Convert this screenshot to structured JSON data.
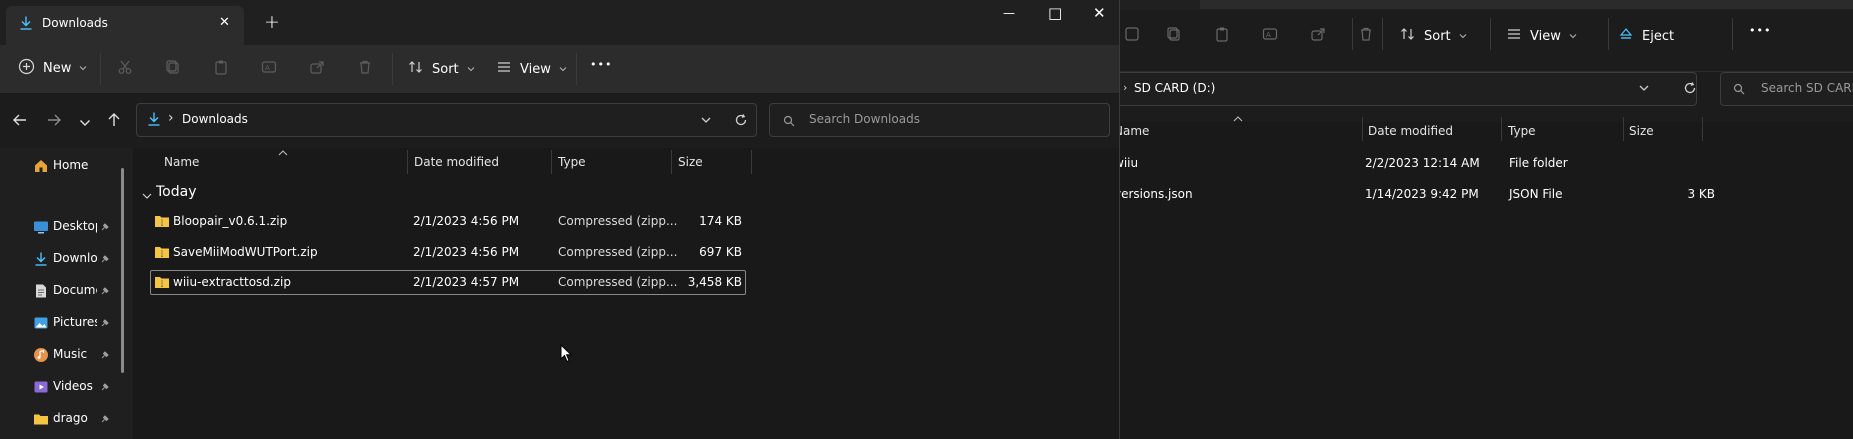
{
  "front_window": {
    "tab": {
      "title": "Downloads",
      "close_symbol": "✕",
      "new_tab_symbol": "+"
    },
    "window_controls": {
      "minimize": "—",
      "maximize": "□",
      "close": "✕"
    },
    "toolbar": {
      "new_label": "New",
      "sort_label": "Sort",
      "view_label": "View",
      "more_label": "•••"
    },
    "address": {
      "breadcrumb": "Downloads",
      "search_placeholder": "Search Downloads"
    },
    "nav": {
      "home": "Home",
      "items": [
        {
          "label": "Desktop",
          "icon": "desktop-icon"
        },
        {
          "label": "Downloads",
          "icon": "download-icon"
        },
        {
          "label": "Documents",
          "icon": "document-icon"
        },
        {
          "label": "Pictures",
          "icon": "picture-icon"
        },
        {
          "label": "Music",
          "icon": "music-icon"
        },
        {
          "label": "Videos",
          "icon": "video-icon"
        },
        {
          "label": "drago",
          "icon": "folder-icon"
        }
      ]
    },
    "columns": {
      "name": "Name",
      "date": "Date modified",
      "type": "Type",
      "size": "Size"
    },
    "group_label": "Today",
    "files": [
      {
        "name": "Bloopair_v0.6.1.zip",
        "date": "2/1/2023 4:56 PM",
        "type": "Compressed (zipp...",
        "size": "174 KB"
      },
      {
        "name": "SaveMiiModWUTPort.zip",
        "date": "2/1/2023 4:56 PM",
        "type": "Compressed (zipp...",
        "size": "697 KB"
      },
      {
        "name": "wiiu-extracttosd.zip",
        "date": "2/1/2023 4:57 PM",
        "type": "Compressed (zipp...",
        "size": "3,458 KB"
      }
    ]
  },
  "back_window": {
    "toolbar": {
      "sort_label": "Sort",
      "view_label": "View",
      "eject_label": "Eject",
      "more_label": "•••"
    },
    "address": {
      "breadcrumb": "SD CARD (D:)",
      "search_placeholder": "Search SD CARD (D:)"
    },
    "columns": {
      "name": "Name",
      "date": "Date modified",
      "type": "Type",
      "size": "Size"
    },
    "files": [
      {
        "name": "wiiu",
        "date": "2/2/2023 12:14 AM",
        "type": "File folder",
        "size": ""
      },
      {
        "name": "versions.json",
        "date": "1/14/2023 9:42 PM",
        "type": "JSON File",
        "size": "3 KB"
      }
    ]
  },
  "colors": {
    "accent": "#4cc2ff",
    "folder": "#f5c542",
    "background": "#191919"
  }
}
